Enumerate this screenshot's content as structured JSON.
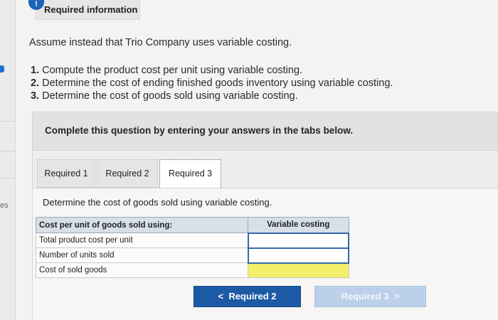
{
  "header": {
    "badge_icon": "info-icon",
    "badge_text": "!",
    "title": "Required information"
  },
  "side": {
    "partial_text": "es"
  },
  "problem": {
    "intro": "Assume instead that Trio Company uses variable costing.",
    "steps": [
      {
        "num": "1.",
        "text": "Compute the product cost per unit using variable costing."
      },
      {
        "num": "2.",
        "text": "Determine the cost of ending finished goods inventory using variable costing."
      },
      {
        "num": "3.",
        "text": "Determine the cost of goods sold using variable costing."
      }
    ]
  },
  "instruction_box": "Complete this question by entering your answers in the tabs below.",
  "tabs": [
    {
      "label": "Required 1",
      "active": false
    },
    {
      "label": "Required 2",
      "active": false
    },
    {
      "label": "Required 3",
      "active": true
    }
  ],
  "tab_content": {
    "instruction": "Determine the cost of goods sold using variable costing.",
    "table": {
      "header_label": "Cost per unit of goods sold using:",
      "header_value": "Variable costing",
      "rows": [
        {
          "label": "Total product cost per unit",
          "value": ""
        },
        {
          "label": "Number of units sold",
          "value": ""
        },
        {
          "label": "Cost of sold goods",
          "value": ""
        }
      ]
    }
  },
  "nav": {
    "prev_label": "Required 2",
    "prev_icon": "<",
    "next_label": "Required 3",
    "next_icon": ">"
  },
  "colors": {
    "accent": "#1d5aa6",
    "highlight": "#f2ef6a",
    "table_header": "#d7dfe7"
  }
}
